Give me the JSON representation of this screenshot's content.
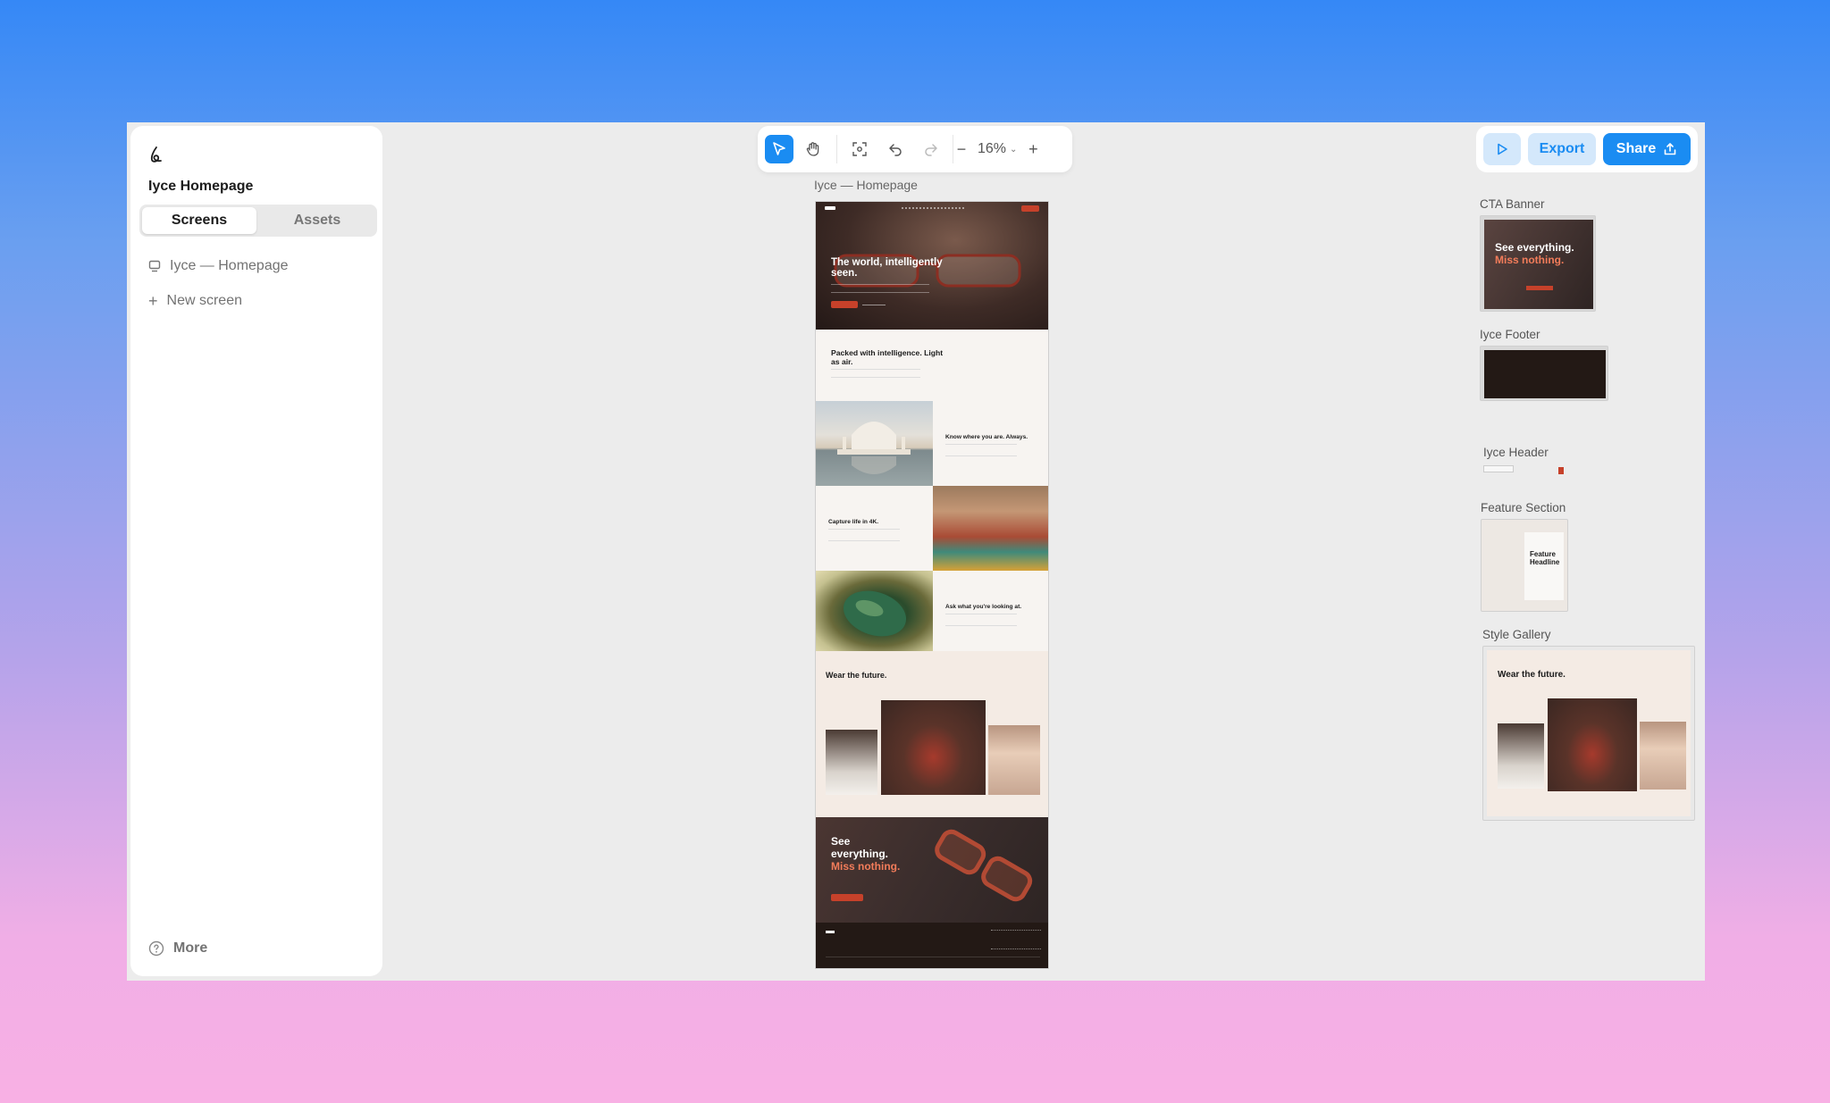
{
  "project": {
    "name": "Iyce Homepage"
  },
  "sidebar": {
    "tabs": [
      "Screens",
      "Assets"
    ],
    "screens": [
      "Iyce — Homepage"
    ],
    "new_screen": "New screen",
    "more": "More"
  },
  "toolbar": {
    "zoom": "16%"
  },
  "actions": {
    "export": "Export",
    "share": "Share"
  },
  "canvas": {
    "frame_label": "Iyce — Homepage",
    "hero": {
      "title": "The world, intelligently seen."
    },
    "intro": {
      "title": "Packed with intelligence. Light as air."
    },
    "features": [
      "Know where you are. Always.",
      "Capture life in 4K.",
      "Ask what you're looking at."
    ],
    "styles": {
      "title": "Wear the future."
    },
    "cta": {
      "line1": "See",
      "line2": "everything.",
      "line3": "Miss nothing."
    }
  },
  "components": [
    {
      "label": "CTA Banner",
      "thumb_title": "See everything.",
      "thumb_highlight": "Miss nothing."
    },
    {
      "label": "Iyce Footer"
    },
    {
      "label": "Iyce Header"
    },
    {
      "label": "Feature Section",
      "thumb_title": "Feature Headline"
    },
    {
      "label": "Style Gallery",
      "thumb_title": "Wear the future."
    }
  ],
  "colors": {
    "accent": "#1a8cf2",
    "brand": "#c6412a",
    "highlight": "#f27c5a"
  }
}
